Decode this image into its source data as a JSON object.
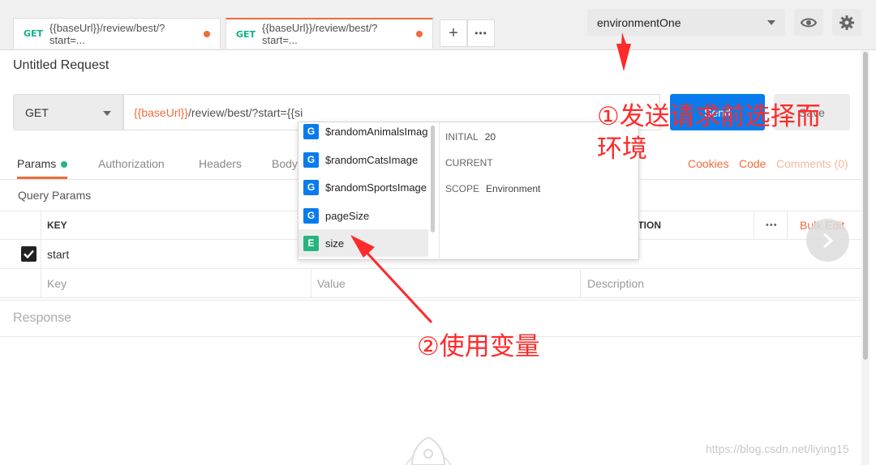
{
  "tabs": [
    {
      "method": "GET",
      "url": "{{baseUrl}}/review/best/?start=..."
    },
    {
      "method": "GET",
      "url": "{{baseUrl}}/review/best/?start=..."
    }
  ],
  "tab_actions": {
    "add": "+",
    "more": "•••"
  },
  "environment": {
    "selected": "environmentOne"
  },
  "request": {
    "title": "Untitled Request",
    "method": "GET",
    "url_var": "{{baseUrl}}",
    "url_rest": "/review/best/?start={{si",
    "send_label": "Send",
    "save_label": "Save"
  },
  "subtabs": {
    "params": "Params",
    "authorization": "Authorization",
    "headers": "Headers",
    "body": "Body",
    "cookies": "Cookies",
    "code": "Code",
    "comments": "Comments (0)"
  },
  "query": {
    "section_label": "Query Params",
    "headers": {
      "key": "KEY",
      "description": "DESCRIPTION"
    },
    "bulk_edit": "Bulk Edit",
    "more": "•••",
    "rows": [
      {
        "key": "start",
        "checked": true
      }
    ],
    "placeholders": {
      "key": "Key",
      "value": "Value",
      "description": "Description"
    }
  },
  "response_label": "Response",
  "autocomplete": {
    "items": [
      {
        "type": "G",
        "name": "$randomAnimalsImage"
      },
      {
        "type": "G",
        "name": "$randomCatsImage"
      },
      {
        "type": "G",
        "name": "$randomSportsImage"
      },
      {
        "type": "G",
        "name": "pageSize"
      },
      {
        "type": "E",
        "name": "size"
      }
    ],
    "info": {
      "initial_label": "INITIAL",
      "initial_value": "20",
      "current_label": "CURRENT",
      "current_value": "",
      "scope_label": "SCOPE",
      "scope_value": "Environment"
    }
  },
  "annotations": {
    "one": "①发送请求前选择而环境",
    "one_line1": "①发送请求前选择而",
    "one_line2": "环境",
    "two": "②使用变量"
  },
  "watermark": "https://blog.csdn.net/liying15",
  "colors": {
    "accent": "#f26b3a",
    "send": "#097bed",
    "annotation": "#ff2a2a",
    "env_badge": "#26b47f"
  }
}
